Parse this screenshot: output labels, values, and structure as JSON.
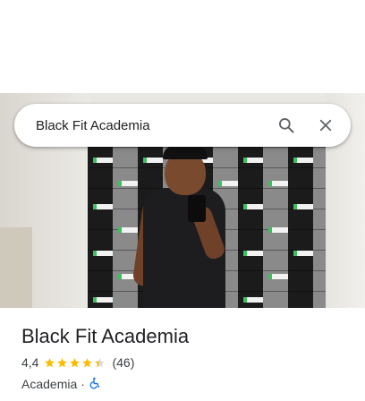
{
  "search": {
    "value": "Black Fit Academia",
    "search_icon": "search-icon",
    "clear_icon": "close-icon"
  },
  "place": {
    "title": "Black Fit Academia",
    "rating": "4,4",
    "rating_value": 4.4,
    "stars_max": 5,
    "review_count": "(46)",
    "category": "Academia",
    "separator": "·",
    "accessibility_icon": "wheelchair-icon"
  },
  "colors": {
    "star": "#fbbc04",
    "accessibility": "#1a73e8",
    "text_primary": "#202124",
    "text_secondary": "#3c4043"
  }
}
